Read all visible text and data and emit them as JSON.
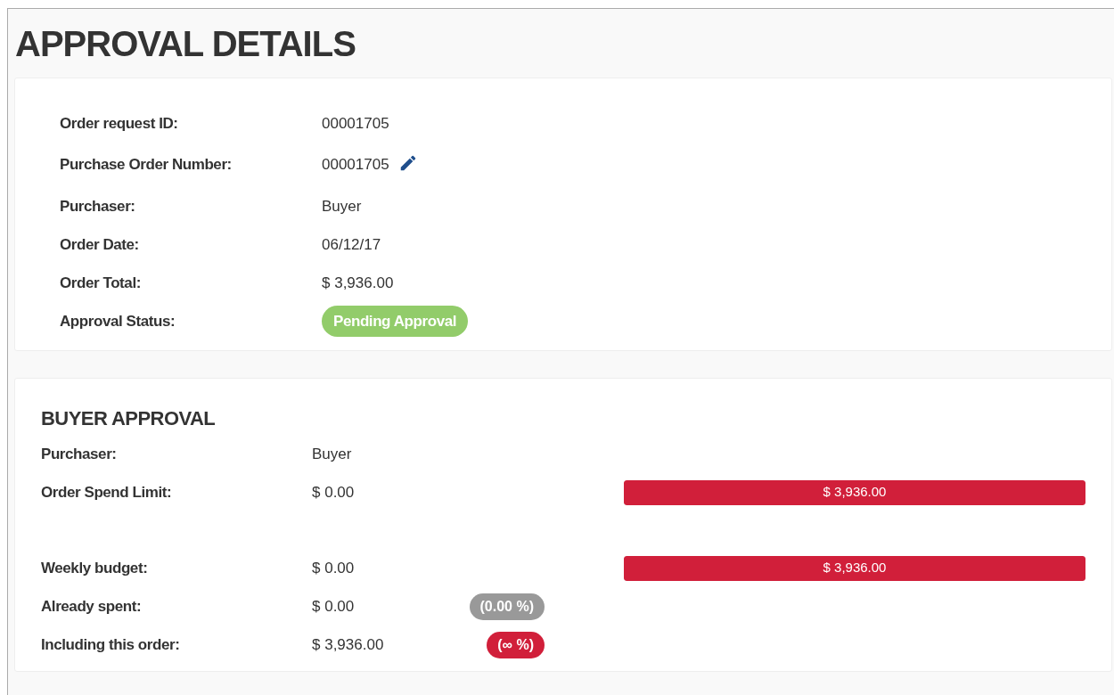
{
  "title": "APPROVAL DETAILS",
  "details": [
    {
      "kind": "text",
      "label": "Order request ID:",
      "value": "00001705"
    },
    {
      "kind": "editable",
      "label": "Purchase Order Number:",
      "value": "00001705"
    },
    {
      "kind": "text",
      "label": "Purchaser:",
      "value": "Buyer"
    },
    {
      "kind": "text",
      "label": "Order Date:",
      "value": "06/12/17"
    },
    {
      "kind": "text",
      "label": "Order Total:",
      "value": "$ 3,936.00"
    },
    {
      "kind": "status",
      "label": "Approval Status:",
      "value": "Pending Approval",
      "color": "#92cc6a"
    }
  ],
  "buyer_approval": {
    "heading": "BUYER APPROVAL",
    "groups": [
      {
        "rows": [
          {
            "kind": "text",
            "label": "Purchaser:",
            "value": "Buyer"
          },
          {
            "kind": "bar",
            "label": "Order Spend Limit:",
            "value": "$ 0.00",
            "bar_text": "$ 3,936.00",
            "level": 1
          }
        ]
      },
      {
        "rows": [
          {
            "kind": "bar",
            "label": "Weekly budget:",
            "value": "$ 0.00",
            "bar_text": "$ 3,936.00",
            "level": 1
          },
          {
            "kind": "badge",
            "label": "Already spent:",
            "value": "$ 0.00",
            "badge": "(0.00 %)",
            "color": "#999999"
          },
          {
            "kind": "badge",
            "label": "Including this order:",
            "value": "$ 3,936.00",
            "badge": "(∞ %)",
            "color": "#d11f3a"
          }
        ]
      }
    ]
  }
}
